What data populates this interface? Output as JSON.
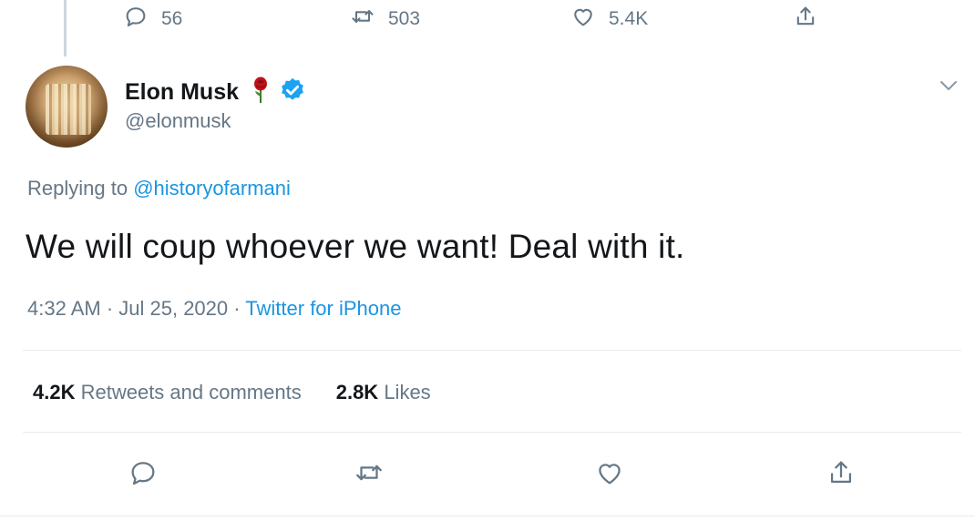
{
  "parent_tweet": {
    "reply_count": "56",
    "retweet_count": "503",
    "like_count": "5.4K"
  },
  "author": {
    "display_name": "Elon Musk",
    "handle": "@elonmusk",
    "emoji_icon": "rose-icon",
    "verified_icon": "verified-badge-icon"
  },
  "tweet": {
    "replying_prefix": "Replying to ",
    "replying_to": "@historyofarmani",
    "text": "We will coup whoever we want! Deal with it.",
    "timestamp": "4:32 AM · Jul 25, 2020 · ",
    "source": "Twitter for iPhone"
  },
  "stats": {
    "retweets_count": "4.2K",
    "retweets_label": " Retweets and comments",
    "likes_count": "2.8K",
    "likes_label": " Likes"
  },
  "colors": {
    "link": "#1b95e0",
    "muted": "#657786",
    "text": "#14171a",
    "verified": "#1da1f2",
    "rose": "#c0101a"
  }
}
